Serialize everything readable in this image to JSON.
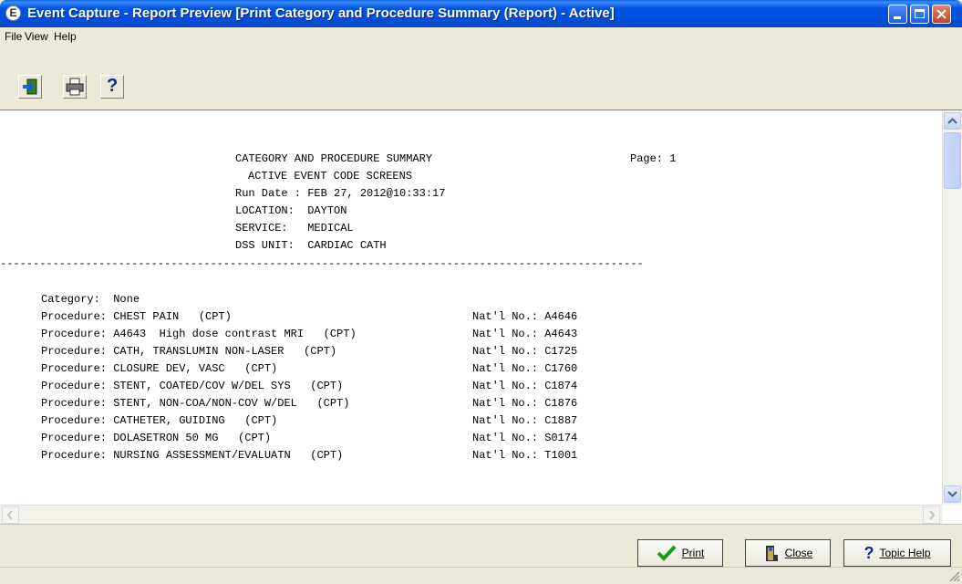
{
  "window": {
    "title": "Event Capture - Report Preview [Print Category and Procedure Summary (Report) - Active]"
  },
  "menu": {
    "file": "File",
    "view": "View",
    "help": "Help"
  },
  "toolbar": {
    "icons": [
      "exit-icon",
      "print-icon",
      "help-question-icon"
    ],
    "help_glyph": "?"
  },
  "report": {
    "header_title": "CATEGORY AND PROCEDURE SUMMARY",
    "page_label": "Page: 1",
    "subtitle": "ACTIVE EVENT CODE SCREENS",
    "run_date": "Run Date : FEB 27, 2012@10:33:17",
    "location": "LOCATION:  DAYTON",
    "service": "SERVICE:   MEDICAL",
    "dss_unit": "DSS UNIT:  CARDIAC CATH",
    "divider": "--------------------------------------------------------------------------------------------------",
    "category": "Category:  None",
    "procedures": [
      {
        "name": "Procedure: CHEST PAIN   (CPT)",
        "nat": "Nat'l No.: A4646"
      },
      {
        "name": "Procedure: A4643  High dose contrast MRI   (CPT)",
        "nat": "Nat'l No.: A4643"
      },
      {
        "name": "Procedure: CATH, TRANSLUMIN NON-LASER   (CPT)",
        "nat": "Nat'l No.: C1725"
      },
      {
        "name": "Procedure: CLOSURE DEV, VASC   (CPT)",
        "nat": "Nat'l No.: C1760"
      },
      {
        "name": "Procedure: STENT, COATED/COV W/DEL SYS   (CPT)",
        "nat": "Nat'l No.: C1874"
      },
      {
        "name": "Procedure: STENT, NON-COA/NON-COV W/DEL   (CPT)",
        "nat": "Nat'l No.: C1876"
      },
      {
        "name": "Procedure: CATHETER, GUIDING   (CPT)",
        "nat": "Nat'l No.: C1887"
      },
      {
        "name": "Procedure: DOLASETRON 50 MG   (CPT)",
        "nat": "Nat'l No.: S0174"
      },
      {
        "name": "Procedure: NURSING ASSESSMENT/EVALUATN   (CPT)",
        "nat": "Nat'l No.: T1001"
      }
    ]
  },
  "buttons": {
    "print": "Print",
    "close": "Close",
    "topic_help": "Topic Help"
  },
  "colors": {
    "title_bar": "#0054e3",
    "window_bg": "#ece9d8",
    "close_button": "#c8401f",
    "print_check": "#1a9a1a"
  }
}
